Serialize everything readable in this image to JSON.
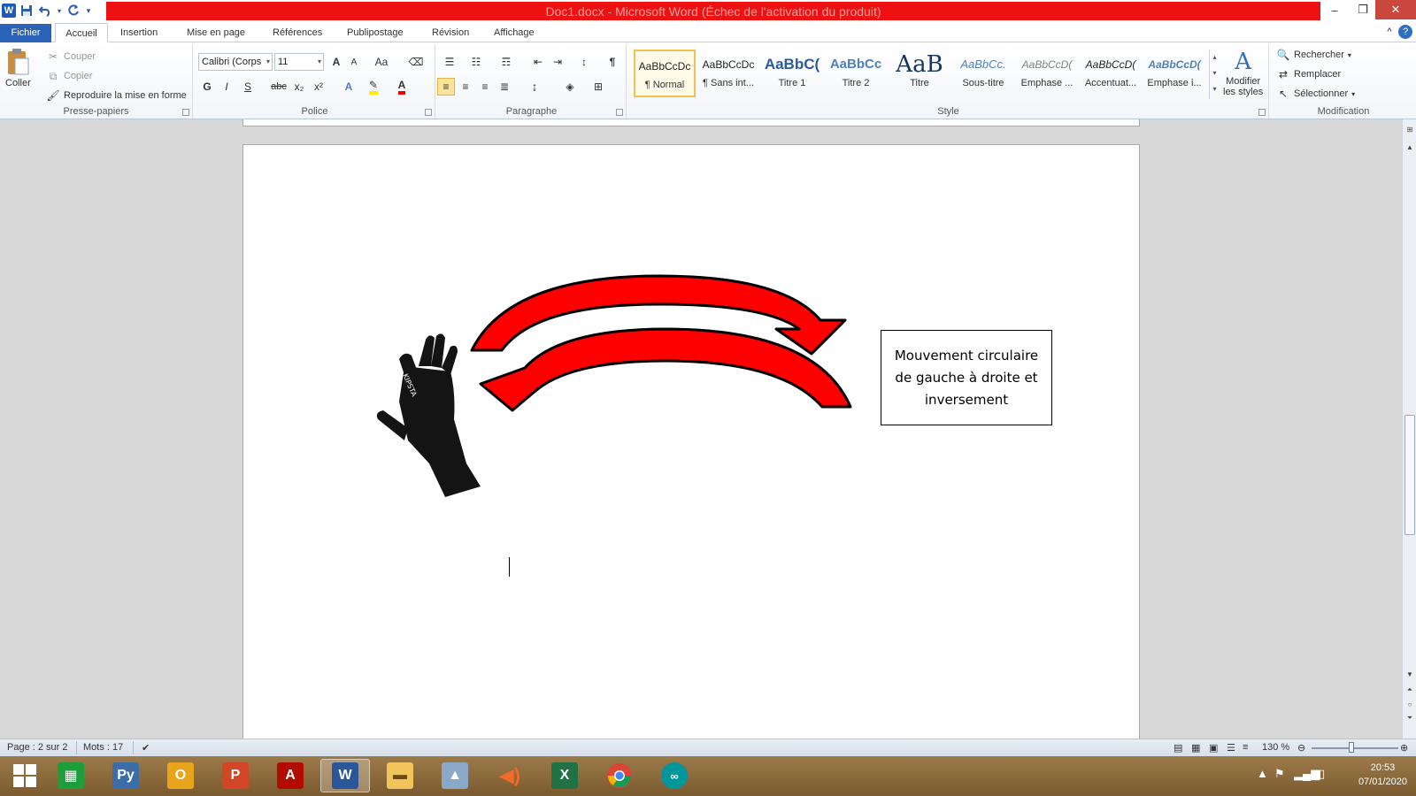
{
  "window": {
    "title": "Doc1.docx - Microsoft Word (Échec de l'activation du produit)",
    "minimize_icon": "minimize-icon",
    "restore_icon": "restore-icon",
    "close_icon": "close-icon"
  },
  "qat": {
    "app_letter": "W",
    "save_icon": "save-icon",
    "undo_icon": "undo-icon",
    "redo_icon": "redo-icon",
    "customize_icon": "chevron-down-icon"
  },
  "tabs": [
    {
      "label": "Fichier"
    },
    {
      "label": "Accueil"
    },
    {
      "label": "Insertion"
    },
    {
      "label": "Mise en page"
    },
    {
      "label": "Références"
    },
    {
      "label": "Publipostage"
    },
    {
      "label": "Révision"
    },
    {
      "label": "Affichage"
    }
  ],
  "ribbon": {
    "clipboard": {
      "paste": "Coller",
      "cut": "Couper",
      "copy": "Copier",
      "format_painter": "Reproduire la mise en forme",
      "group": "Presse-papiers"
    },
    "font": {
      "family": "Calibri (Corps",
      "size": "11",
      "grow": "A",
      "shrink": "A",
      "case": "Aa",
      "bold": "G",
      "italic": "I",
      "underline": "S",
      "strike": "abc",
      "subscript": "x₂",
      "superscript": "x²",
      "group": "Police"
    },
    "paragraph": {
      "pilcrow": "¶",
      "group": "Paragraphe"
    },
    "styles": {
      "items": [
        {
          "preview": "AaBbCcDc",
          "name": "¶ Normal",
          "color": "#000000"
        },
        {
          "preview": "AaBbCcDc",
          "name": "¶ Sans int...",
          "color": "#000000"
        },
        {
          "preview": "AaBbC(",
          "name": "Titre 1",
          "color": "#2a5b9e"
        },
        {
          "preview": "AaBbCc",
          "name": "Titre 2",
          "color": "#4f81bd"
        },
        {
          "preview": "AaB",
          "name": "Titre",
          "color": "#17365d"
        },
        {
          "preview": "AaBbCc.",
          "name": "Sous-titre",
          "color": "#4f81bd"
        },
        {
          "preview": "AaBbCcD(",
          "name": "Emphase ...",
          "color": "#808080"
        },
        {
          "preview": "AaBbCcD(",
          "name": "Accentuat...",
          "color": "#000000"
        },
        {
          "preview": "AaBbCcD(",
          "name": "Emphase i...",
          "color": "#4f81bd"
        }
      ],
      "modify": "Modifier",
      "modify2": "les styles",
      "group": "Style"
    },
    "editing": {
      "find": "Rechercher",
      "replace": "Remplacer",
      "select": "Sélectionner",
      "group": "Modification"
    }
  },
  "document": {
    "textbox": "Mouvement circulaire de gauche à droite et inversement",
    "glove_brand": "KIPSTA",
    "arrow_color": "#ff0000"
  },
  "status": {
    "page": "Page : 2 sur 2",
    "words": "Mots : 17",
    "zoom": "130 %"
  },
  "taskbar": {
    "time": "20:53",
    "date": "07/01/2020",
    "apps": [
      {
        "name": "start-button"
      },
      {
        "name": "store-app"
      },
      {
        "name": "python-app"
      },
      {
        "name": "outlook-app"
      },
      {
        "name": "powerpoint-app"
      },
      {
        "name": "acrobat-app"
      },
      {
        "name": "word-app"
      },
      {
        "name": "explorer-app"
      },
      {
        "name": "photos-app"
      },
      {
        "name": "speaker-app"
      },
      {
        "name": "excel-app"
      },
      {
        "name": "chrome-app"
      },
      {
        "name": "arduino-app"
      }
    ]
  }
}
